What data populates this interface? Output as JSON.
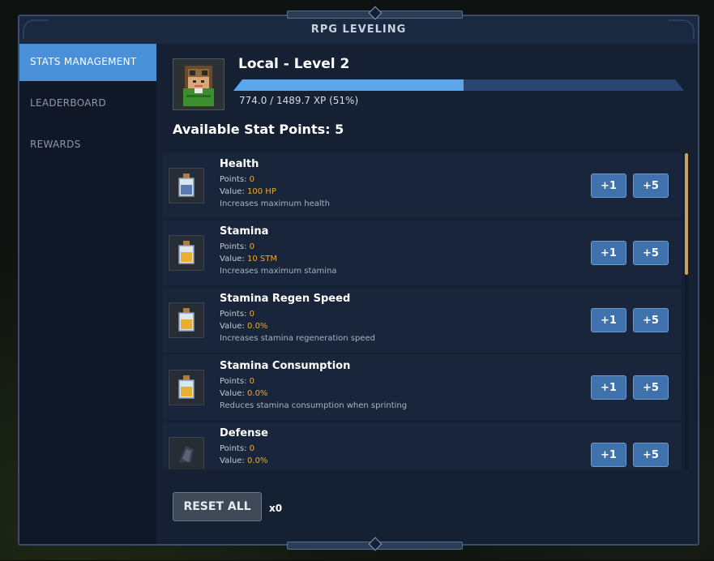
{
  "window": {
    "title": "RPG LEVELING"
  },
  "sidebar": {
    "items": [
      {
        "label": "STATS MANAGEMENT",
        "active": true
      },
      {
        "label": "LEADERBOARD",
        "active": false
      },
      {
        "label": "REWARDS",
        "active": false
      }
    ]
  },
  "player": {
    "title": "Local - Level 2",
    "xp_text": "774.0 / 1489.7 XP (51%)",
    "xp_fraction": 0.51
  },
  "stats_header": "Available Stat Points: 5",
  "labels": {
    "points": "Points:",
    "value": "Value:",
    "plus1": "+1",
    "plus5": "+5"
  },
  "stats": [
    {
      "name": "Health",
      "points": "0",
      "value": "100 HP",
      "description": "Increases maximum health",
      "icon": "health-potion-icon"
    },
    {
      "name": "Stamina",
      "points": "0",
      "value": "10 STM",
      "description": "Increases maximum stamina",
      "icon": "stamina-potion-icon"
    },
    {
      "name": "Stamina Regen Speed",
      "points": "0",
      "value": "0.0%",
      "description": "Increases stamina regeneration speed",
      "icon": "stamina-potion-icon"
    },
    {
      "name": "Stamina Consumption",
      "points": "0",
      "value": "0.0%",
      "description": "Reduces stamina consumption when sprinting",
      "icon": "stamina-potion-icon"
    },
    {
      "name": "Defense",
      "points": "0",
      "value": "0.0%",
      "description": "",
      "icon": "armor-icon"
    }
  ],
  "footer": {
    "reset_label": "RESET ALL",
    "reset_count": "x0"
  },
  "colors": {
    "accent": "#4a90d9",
    "value": "#f0a830",
    "button": "#3f72ad",
    "scroll": "#caa25a"
  }
}
